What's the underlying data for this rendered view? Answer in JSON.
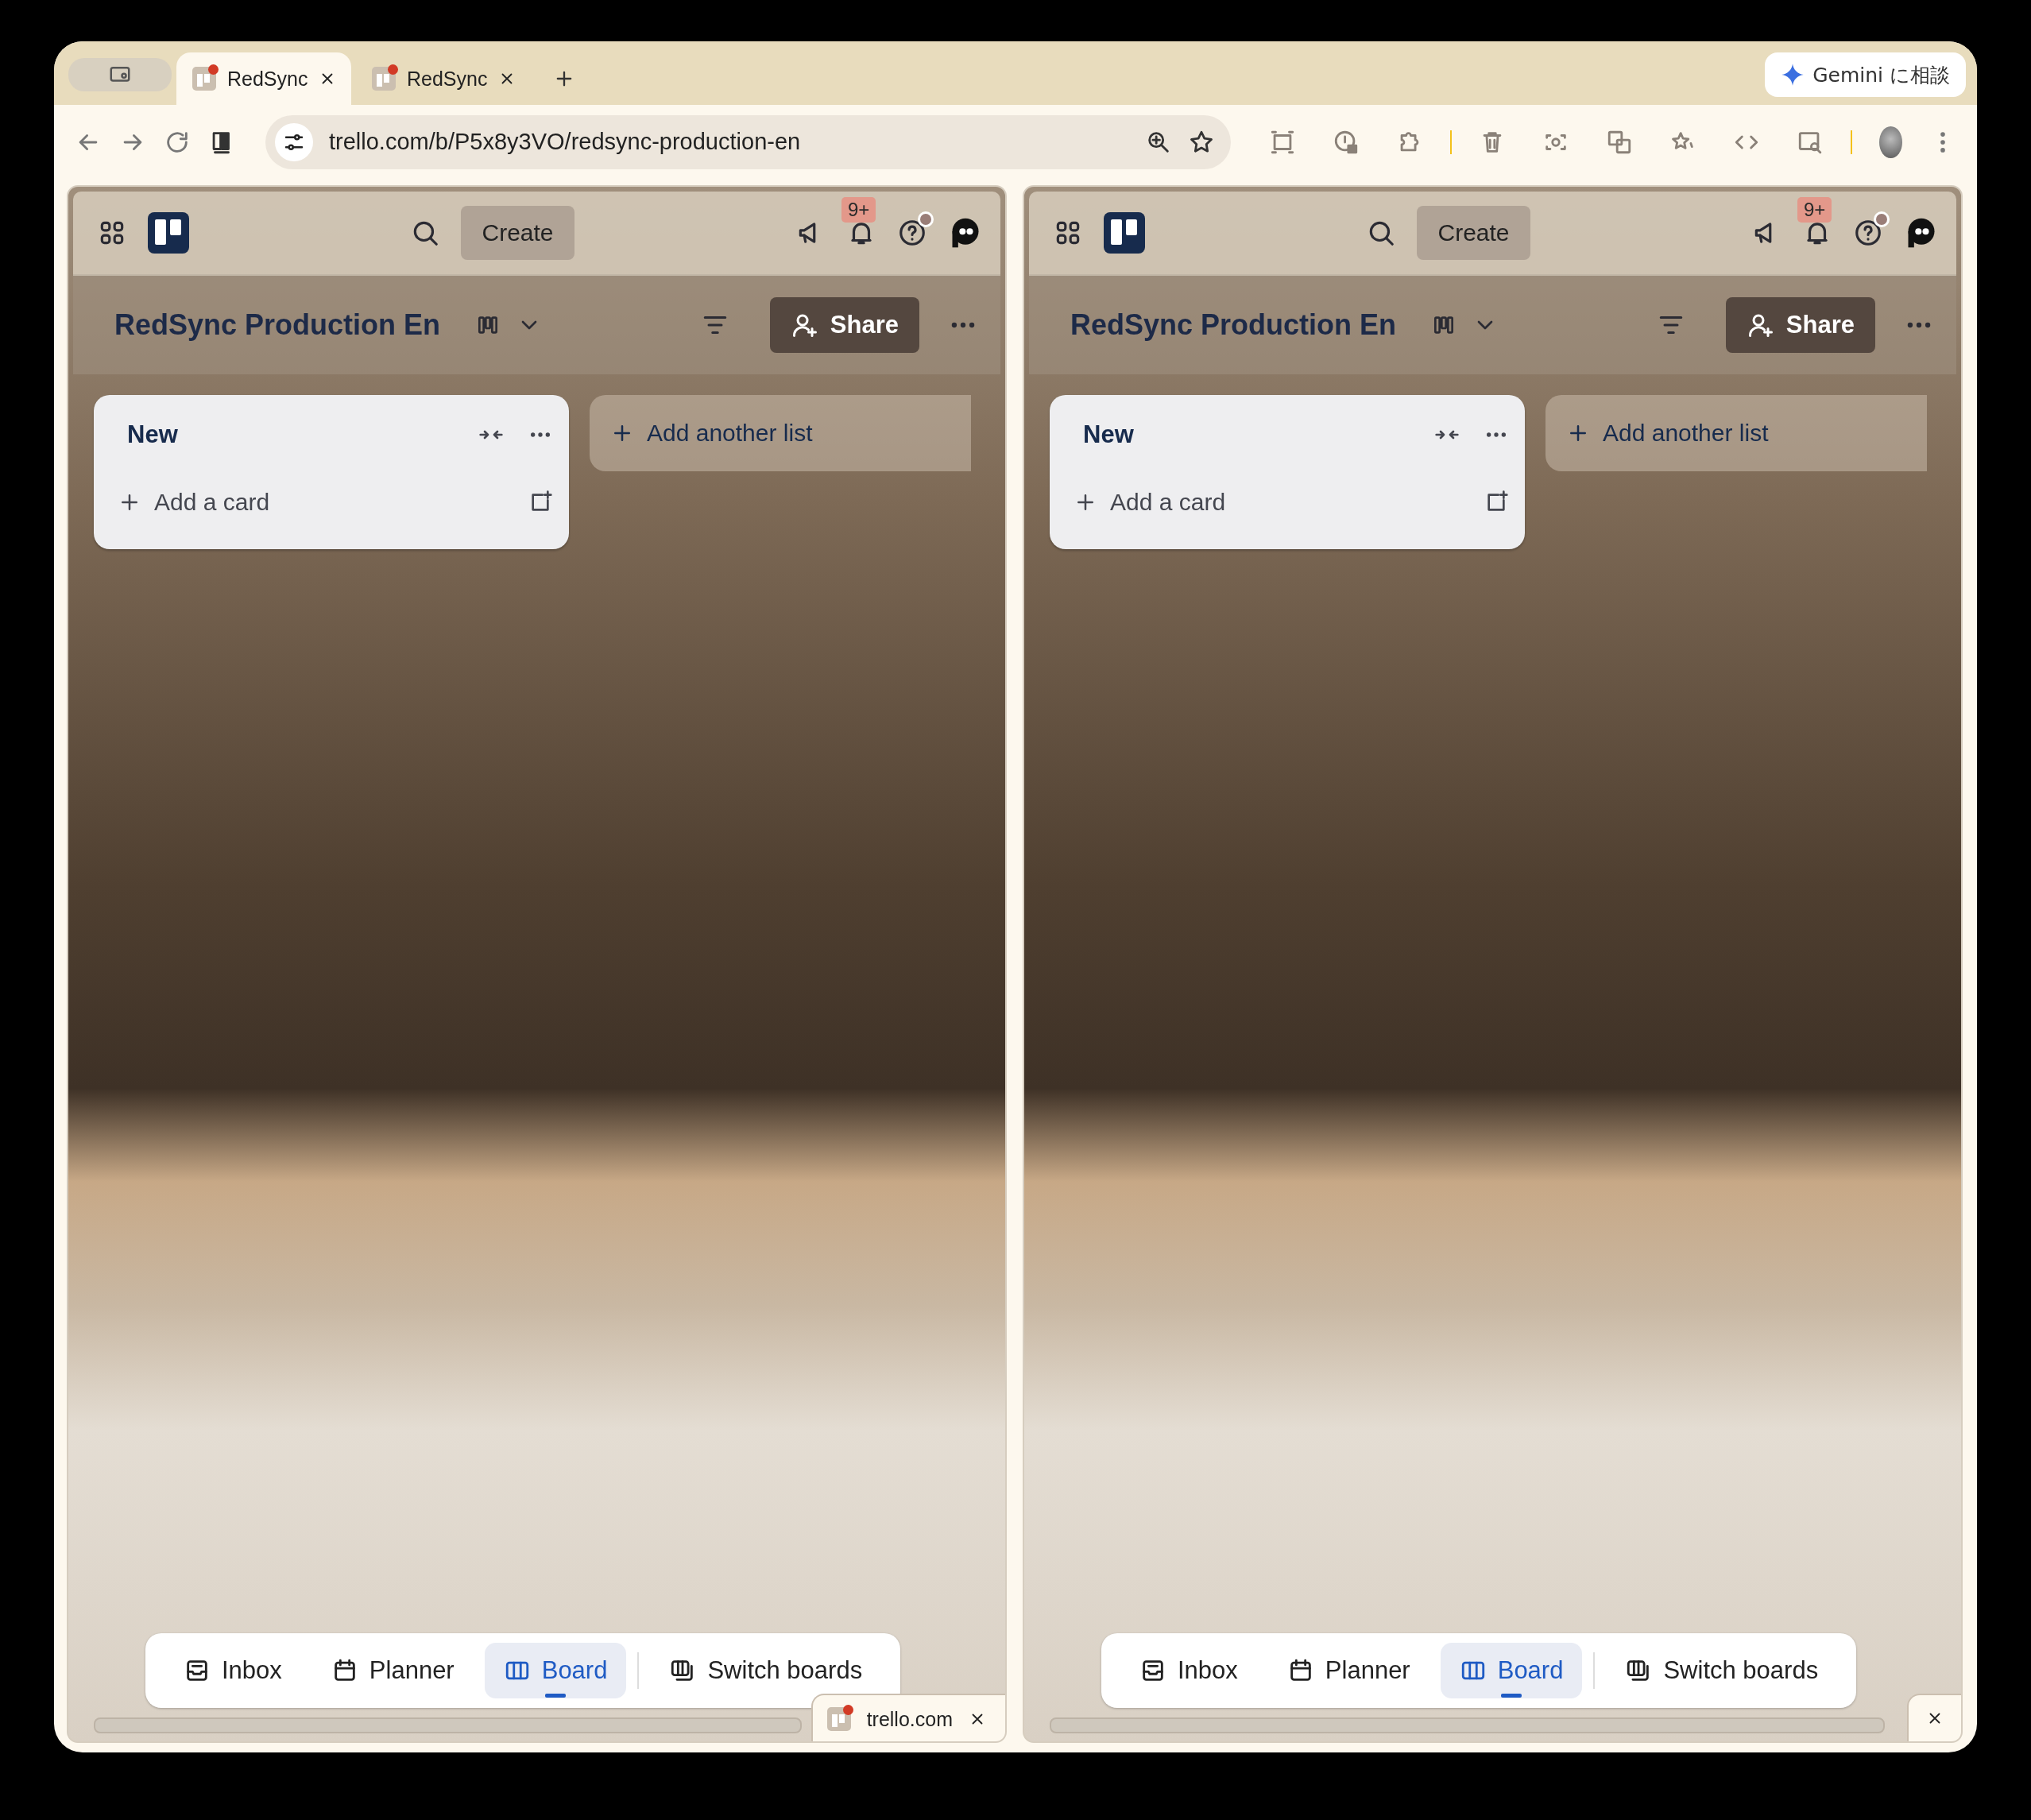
{
  "browser": {
    "tabs": [
      {
        "title": "RedSync",
        "selected": true
      },
      {
        "title": "RedSync",
        "selected": false
      }
    ],
    "assistant_button": "Gemini に相談",
    "address": "trello.com/b/P5x8y3VO/redsync-production-en"
  },
  "panes": [
    {
      "create": "Create",
      "notifications_badge": "9+",
      "board_title": "RedSync Production En",
      "share": "Share",
      "lists": [
        {
          "title": "New",
          "add_card": "Add a card"
        }
      ],
      "add_list": "Add another list",
      "nav": [
        {
          "label": "Inbox",
          "kind": "inbox",
          "selected": false
        },
        {
          "label": "Planner",
          "kind": "planner",
          "selected": false
        },
        {
          "label": "Board",
          "kind": "board",
          "selected": true
        },
        {
          "label": "Switch boards",
          "kind": "switch",
          "selected": false
        }
      ],
      "popup": {
        "kind": "site",
        "text": "trello.com"
      }
    },
    {
      "create": "Create",
      "notifications_badge": "9+",
      "board_title": "RedSync Production En",
      "share": "Share",
      "lists": [
        {
          "title": "New",
          "add_card": "Add a card"
        }
      ],
      "add_list": "Add another list",
      "nav": [
        {
          "label": "Inbox",
          "kind": "inbox",
          "selected": false
        },
        {
          "label": "Planner",
          "kind": "planner",
          "selected": false
        },
        {
          "label": "Board",
          "kind": "board",
          "selected": true
        },
        {
          "label": "Switch boards",
          "kind": "switch",
          "selected": false
        }
      ],
      "popup": {
        "kind": "close"
      }
    }
  ]
}
